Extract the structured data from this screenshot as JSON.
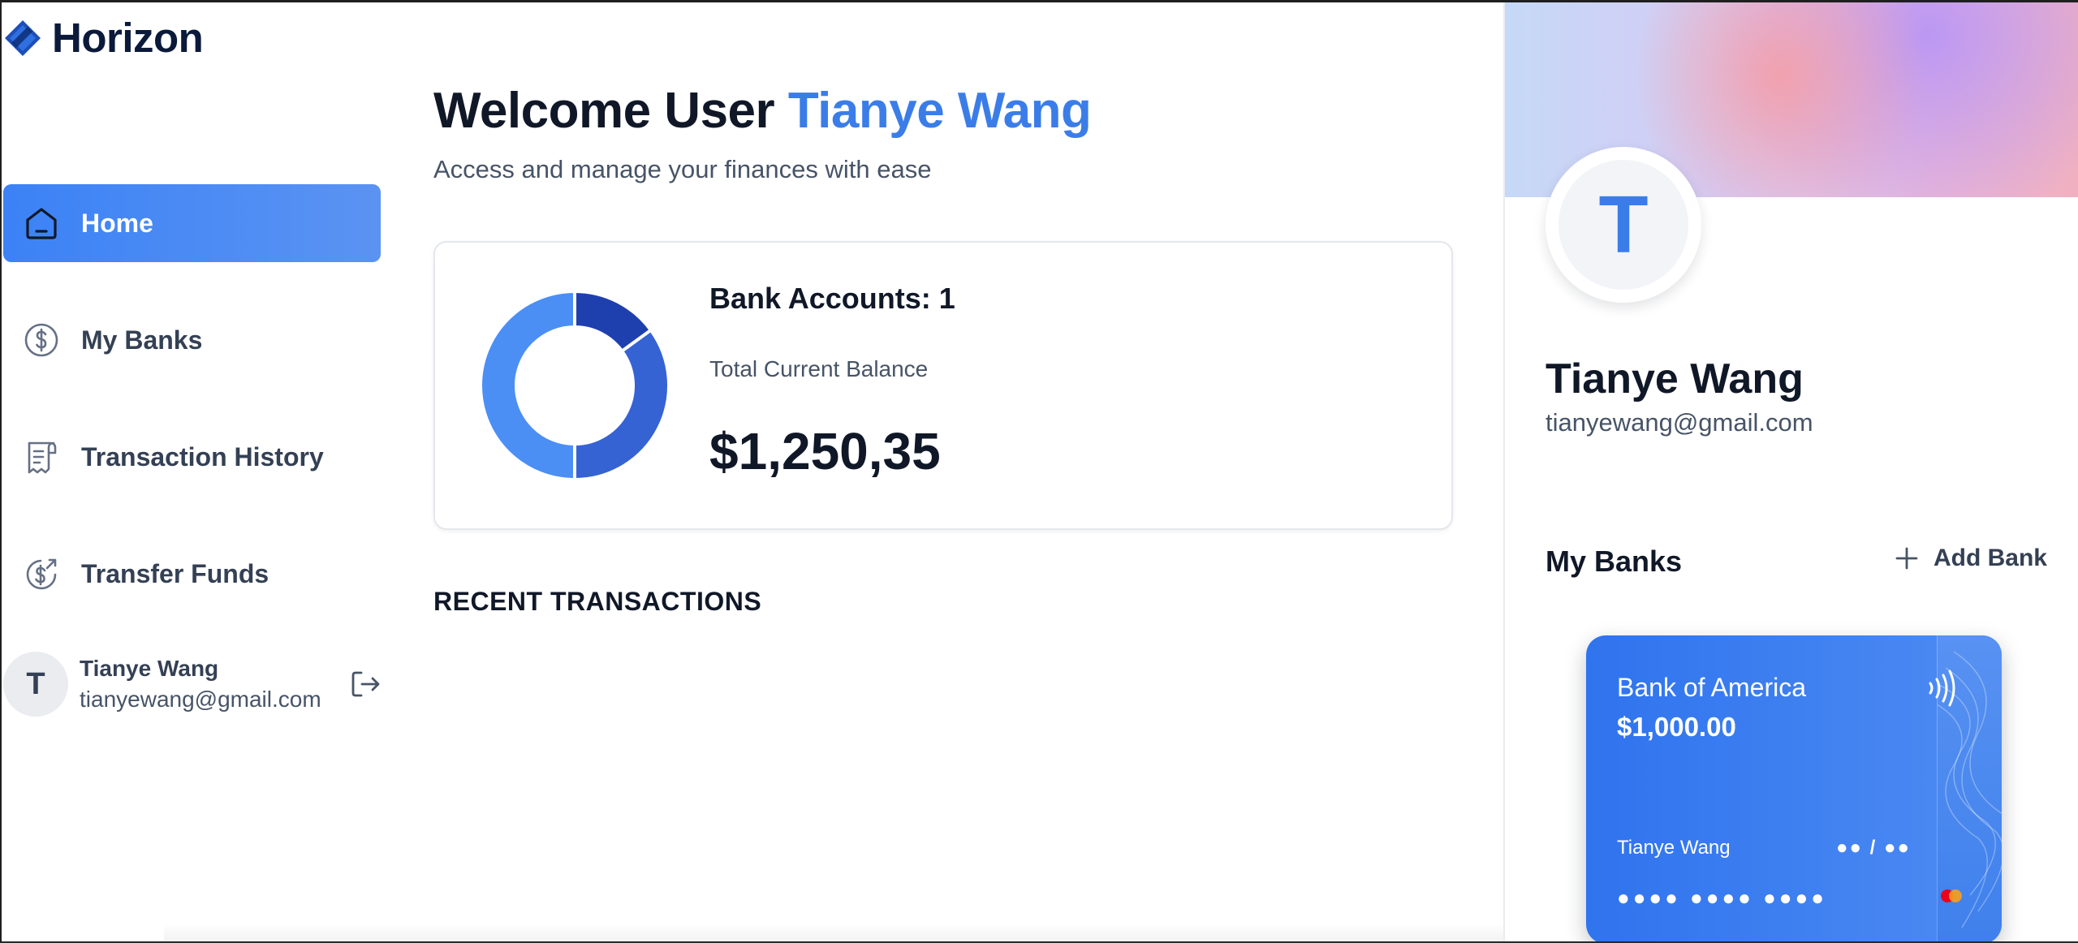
{
  "app": {
    "name": "Horizon"
  },
  "sidebar": {
    "items": [
      {
        "label": "Home",
        "icon": "home-icon",
        "active": true
      },
      {
        "label": "My Banks",
        "icon": "dollar-circle-icon",
        "active": false
      },
      {
        "label": "Transaction History",
        "icon": "receipt-icon",
        "active": false
      },
      {
        "label": "Transfer Funds",
        "icon": "money-send-icon",
        "active": false
      }
    ],
    "footer": {
      "avatar_initial": "T",
      "name": "Tianye Wang",
      "email": "tianyewang@gmail.com",
      "logout_icon": "logout-icon"
    }
  },
  "header": {
    "greeting": "Welcome User",
    "user_name": "Tianye Wang",
    "subtitle": "Access and manage your finances with ease"
  },
  "balance": {
    "accounts_label": "Bank Accounts:",
    "accounts_count": "1",
    "total_label": "Total Current Balance",
    "total_amount": "$1,250,35",
    "chart_colors": [
      "#1e40af",
      "#3563d4",
      "#4b8ff5"
    ]
  },
  "chart_data": {
    "type": "pie",
    "categories": [
      "",
      "",
      ""
    ],
    "values": [
      15,
      35,
      50
    ],
    "colors": [
      "#1e40af",
      "#3563d4",
      "#4b8ff5"
    ]
  },
  "recent": {
    "title": "RECENT TRANSACTIONS"
  },
  "profile": {
    "avatar_initial": "T",
    "name": "Tianye Wang",
    "email": "tianyewang@gmail.com"
  },
  "banks_section": {
    "title": "My Banks",
    "add_label": "Add Bank"
  },
  "bank_card": {
    "bank_name": "Bank of America",
    "balance": "$1,000.00",
    "holder": "Tianye Wang",
    "expiry": "●● / ●●",
    "number": "●●●● ●●●● ●●●●"
  },
  "colors": {
    "accent": "#3b7de8",
    "active_nav": "#3b82f6",
    "text_primary": "#101828",
    "text_secondary": "#475467"
  }
}
